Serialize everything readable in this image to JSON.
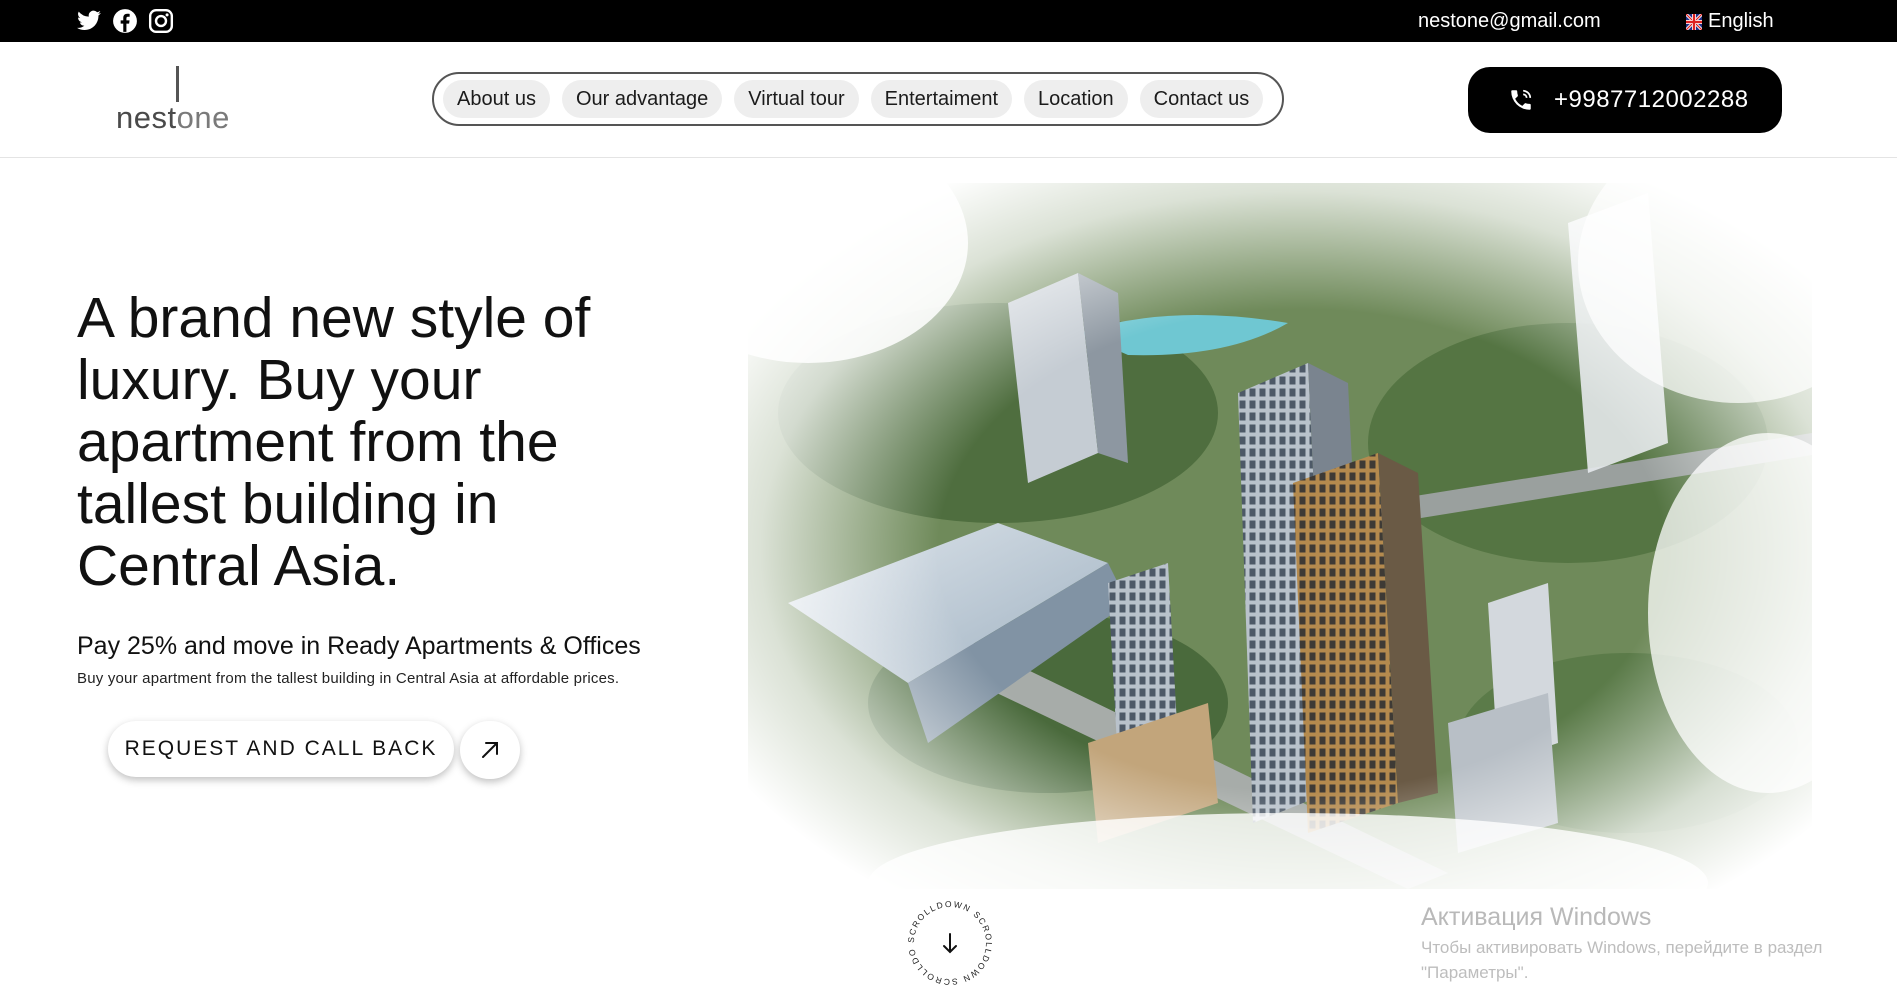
{
  "topbar": {
    "social_icons": [
      "twitter-icon",
      "facebook-icon",
      "instagram-icon"
    ],
    "email": "nestone@gmail.com",
    "language": "English",
    "language_flag": "uk-flag-icon"
  },
  "header": {
    "logo": {
      "prefix": "nest",
      "suffix": "one"
    },
    "nav": [
      {
        "label": "About us"
      },
      {
        "label": "Our advantage"
      },
      {
        "label": "Virtual tour"
      },
      {
        "label": "Entertaiment"
      },
      {
        "label": "Location"
      },
      {
        "label": "Contact us"
      }
    ],
    "phone": "+9987712002288",
    "phone_icon": "phone-icon"
  },
  "hero": {
    "title": "A brand new style of luxury. Buy your apartment from the tallest building in Central Asia.",
    "subtitle": "Pay 25% and move in Ready Apartments & Offices",
    "description": "Buy your apartment from the tallest building in Central Asia at affordable prices.",
    "cta_label": "REQUEST AND CALL BACK",
    "cta_icon": "arrow-up-right-icon",
    "image_alt": "aerial-render-of-tower-complex"
  },
  "scroll_down": {
    "text": "SCROLLDOWN SCROLLDOWN SCROLLDOWN",
    "icon": "arrow-down-icon"
  },
  "windows_watermark": {
    "title": "Активация Windows",
    "text": "Чтобы активировать Windows, перейдите в раздел \"Параметры\"."
  },
  "colors": {
    "topbar": "#000000",
    "phone_button": "#000000",
    "nav_pill": "#eeeeee",
    "watermark": "#b9b9b9"
  }
}
